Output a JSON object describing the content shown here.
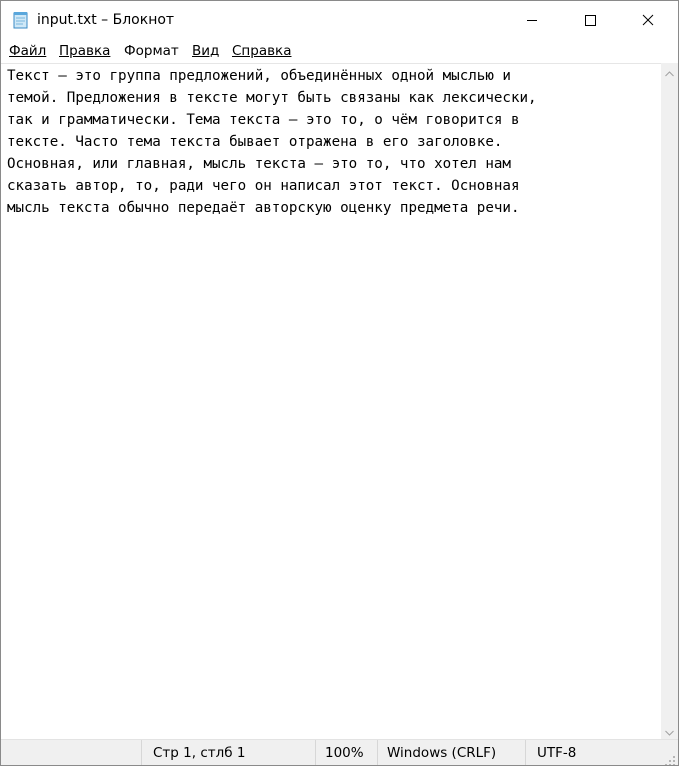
{
  "window": {
    "title": "input.txt – Блокнот"
  },
  "menu": {
    "items": [
      {
        "label": "Файл",
        "accel": "Ф",
        "rest": "айл"
      },
      {
        "label": "Правка",
        "accel": "П",
        "rest": "равка"
      },
      {
        "label": "Формат",
        "accel": "О",
        "rest": "Формат"
      },
      {
        "label": "Вид",
        "accel": "В",
        "rest": "ид"
      },
      {
        "label": "Справка",
        "accel": "С",
        "rest": "правка"
      }
    ]
  },
  "editor": {
    "lines": [
      "Текст — это группа предложений, объединённых одной мыслью и",
      "темой. Предложения в тексте могут быть связаны как лексически,",
      "так и грамматически. Тема текста — это то, о чём говорится в",
      "тексте. Часто тема текста бывает отражена в его заголовке.",
      "Основная, или главная, мысль текста — это то, что хотел нам",
      "сказать автор, то, ради чего он написал этот текст. Основная",
      "мысль текста обычно передаёт авторскую оценку предмета речи."
    ]
  },
  "status": {
    "position": "Стр 1, стлб 1",
    "zoom": "100%",
    "line_endings": "Windows (CRLF)",
    "encoding": "UTF-8"
  },
  "icons": {
    "app": "notepad-icon",
    "minimize": "minimize-icon",
    "maximize": "maximize-icon",
    "close": "close-icon",
    "scroll_up": "chevron-up-icon",
    "scroll_down": "chevron-down-icon",
    "grip": "resize-grip-icon"
  },
  "colors": {
    "chrome": "#f0f0f0",
    "text": "#000000",
    "background": "#ffffff"
  }
}
